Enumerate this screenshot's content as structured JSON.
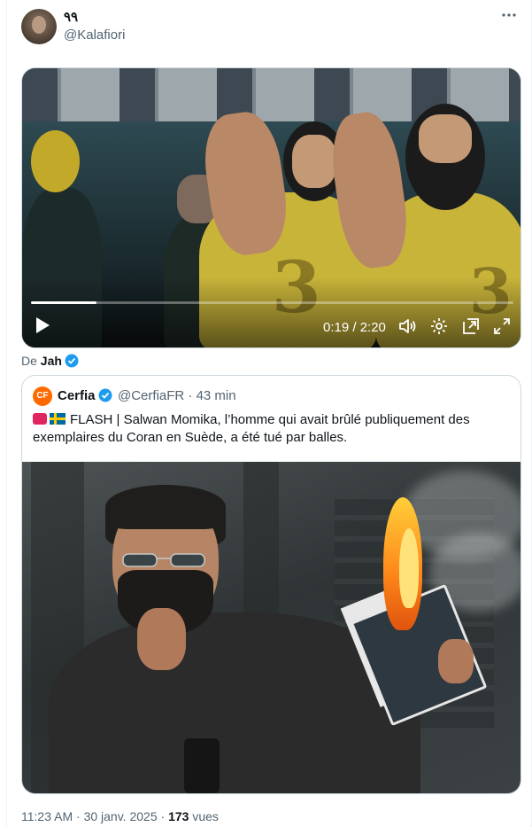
{
  "post": {
    "author": {
      "display_name": "٩٩",
      "handle": "@Kalafiori"
    },
    "more_icon": "ellipsis-icon",
    "video": {
      "current_time": "0:19",
      "duration": "2:20",
      "time_label": "0:19 / 2:20",
      "progress_fraction": 0.136,
      "controls": [
        "play-icon",
        "volume-icon",
        "settings-icon",
        "pip-icon",
        "fullscreen-icon"
      ]
    },
    "source": {
      "prefix": "De",
      "name": "Jah",
      "verified": true
    },
    "quote": {
      "name": "Cerfia",
      "logo_text": "CF",
      "handle": "@CerfiaFR",
      "separator": "·",
      "age": "43 min",
      "verified": true,
      "text": "FLASH | Salwan Momika, l’homme qui avait brûlé publiquement des exemplaires du Coran en Suède, a été tué par balles."
    },
    "meta": {
      "time": "11:23 AM",
      "separator": "·",
      "date": "30 janv. 2025",
      "views": "173",
      "views_label": "vues"
    }
  },
  "colors": {
    "accent": "#1d9bf0",
    "text": "#0f1419",
    "muted": "#536471",
    "border": "#cfd9de",
    "cerfia_logo": "#ff6a00"
  }
}
